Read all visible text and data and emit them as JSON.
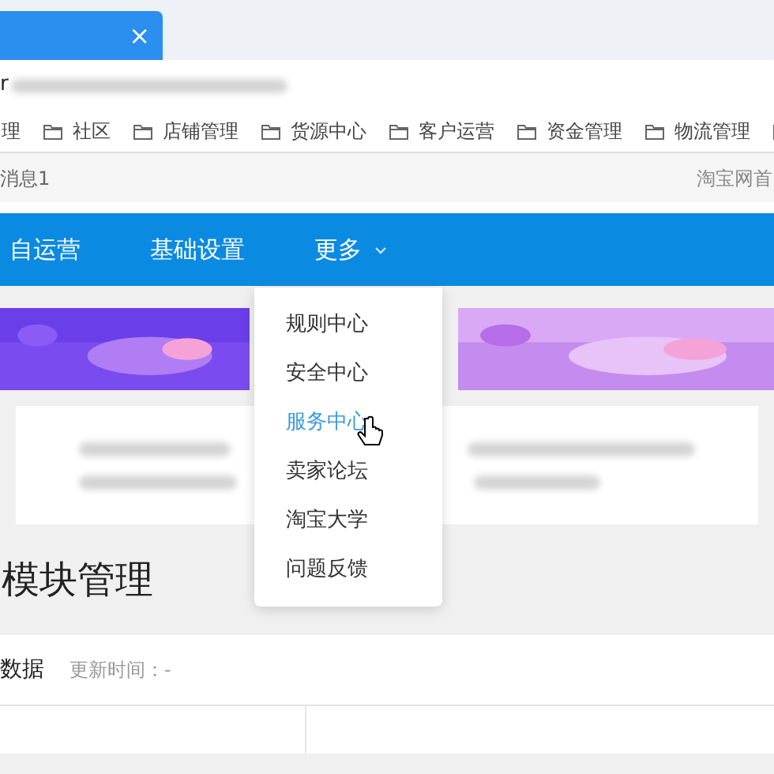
{
  "browser_tab": {
    "close": "×"
  },
  "address_bar": {
    "value": "r"
  },
  "bookmarks": {
    "leading": "理",
    "folders": [
      "社区",
      "店铺管理",
      "货源中心",
      "客户运营",
      "资金管理",
      "物流管理"
    ]
  },
  "top_bar": {
    "messages": "消息1",
    "link": "淘宝网首"
  },
  "nav": [
    {
      "label": "自运营",
      "kind": "link"
    },
    {
      "label": "基础设置",
      "kind": "link"
    },
    {
      "label": "更多",
      "kind": "dropdown"
    }
  ],
  "dropdown": [
    {
      "label": "规则中心",
      "selected": false
    },
    {
      "label": "安全中心",
      "selected": false
    },
    {
      "label": "服务中心",
      "selected": true
    },
    {
      "label": "卖家论坛",
      "selected": false
    },
    {
      "label": "淘宝大学",
      "selected": false
    },
    {
      "label": "问题反馈",
      "selected": false
    }
  ],
  "section": {
    "title": "模块管理",
    "tab": "数据",
    "updated": "更新时间：-"
  }
}
